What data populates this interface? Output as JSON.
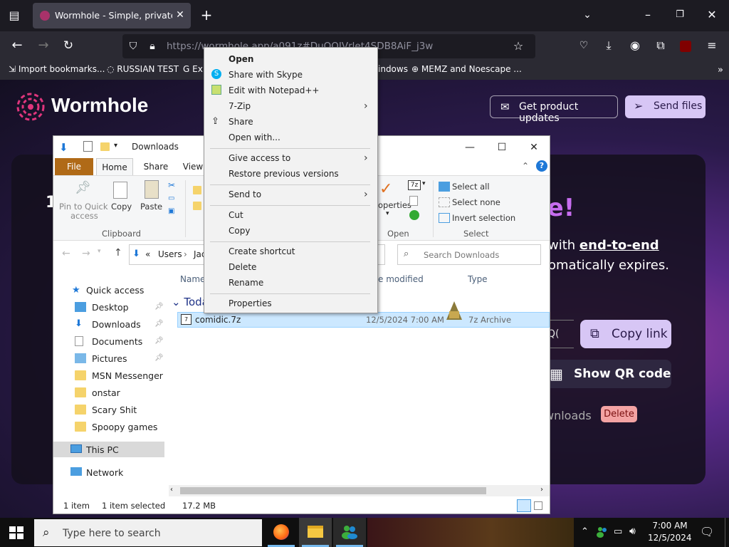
{
  "browser": {
    "tab_title": "Wormhole - Simple, private file",
    "url": "https://wormhole.app/a091z#DuQOIVrlet4SDB8AiF_j3w",
    "new_tab_symbol": "+",
    "bookmarks": [
      {
        "label": "Import bookmarks..."
      },
      {
        "label": "RUSSIAN TEST"
      },
      {
        "label": "Ex"
      },
      {
        "label": "indows"
      },
      {
        "label": "MEMZ and Noescape ..."
      }
    ]
  },
  "page": {
    "brand": "Wormhole",
    "btn_updates": "Get product updates",
    "btn_send": "Send files",
    "hero_fragment": "le!",
    "line1_pre": "with ",
    "line1_bold": "end-to-end",
    "line2": "omatically expires.",
    "btn_copy_link": "Copy link",
    "btn_qr": "Show QR code",
    "qr_fragment": "Q(",
    "downloads_fragment": "wnloads",
    "delete_badge": "Delete",
    "hero_left_fragment": "1"
  },
  "explorer": {
    "title": "Downloads",
    "ribbon_tabs": [
      "File",
      "Home",
      "Share",
      "View"
    ],
    "clipboard": {
      "pin": "Pin to Quick access",
      "pin_line1": "Pin to Quick",
      "pin_line2": "access",
      "copy": "Copy",
      "paste": "Paste",
      "group": "Clipboard"
    },
    "open_group": {
      "properties": "operties",
      "group": "Open"
    },
    "select_group": {
      "select_all": "Select all",
      "select_none": "Select none",
      "invert": "Invert selection",
      "group": "Select"
    },
    "address": {
      "sep": "«",
      "users": "Users",
      "user_fragment": "Jac"
    },
    "search_placeholder": "Search Downloads",
    "columns": {
      "name": "Name",
      "modified": "e modified",
      "type": "Type"
    },
    "group_today": "Toda",
    "file": {
      "name": "comidic.7z",
      "date": "12/5/2024 7:00 AM",
      "type": "7z Archive"
    },
    "nav": {
      "quick_access": "Quick access",
      "items": [
        "Desktop",
        "Downloads",
        "Documents",
        "Pictures",
        "MSN Messenger",
        "onstar",
        "Scary Shit",
        "Spoopy games"
      ],
      "this_pc": "This PC",
      "network": "Network"
    },
    "status": {
      "count": "1 item",
      "selected": "1 item selected",
      "size": "17.2 MB"
    }
  },
  "context_menu": {
    "items": [
      {
        "label": "Open",
        "bold": true
      },
      {
        "label": "Share with Skype"
      },
      {
        "label": "Edit with Notepad++"
      },
      {
        "label": "7-Zip"
      },
      {
        "label": "Share"
      },
      {
        "label": "Open with..."
      },
      {
        "label": "Give access to"
      },
      {
        "label": "Restore previous versions"
      },
      {
        "label": "Send to"
      },
      {
        "label": "Cut"
      },
      {
        "label": "Copy"
      },
      {
        "label": "Create shortcut"
      },
      {
        "label": "Delete"
      },
      {
        "label": "Rename"
      },
      {
        "label": "Properties"
      }
    ]
  },
  "taskbar": {
    "search_placeholder": "Type here to search",
    "time": "7:00 AM",
    "date": "12/5/2024"
  },
  "colors": {
    "accent": "#d7c6f5",
    "brand": "#e0357c",
    "selection": "#cce8ff"
  }
}
